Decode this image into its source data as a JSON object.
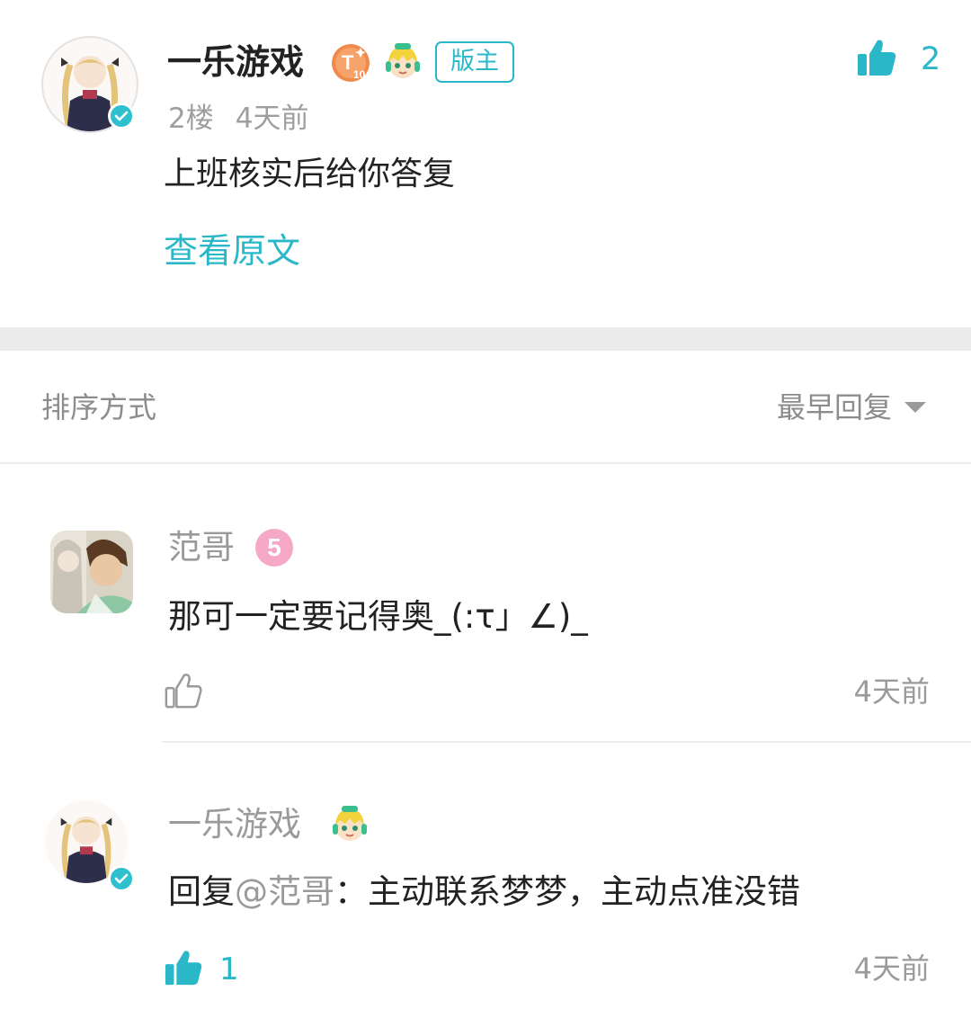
{
  "post": {
    "author": "一乐游戏",
    "level_badge": "T10",
    "mod_badge": "版主",
    "floor": "2楼",
    "time": "4天前",
    "content": "上班核实后给你答复",
    "view_original": "查看原文",
    "like_count": "2"
  },
  "sort": {
    "label": "排序方式",
    "selected": "最早回复"
  },
  "replies": [
    {
      "author": "范哥",
      "level": "5",
      "content": "那可一定要记得奥_(:τ」∠)_",
      "time": "4天前",
      "like_count": ""
    },
    {
      "author": "一乐游戏",
      "reply_prefix": "回复",
      "mention": "@范哥",
      "content": "：主动联系梦梦，主动点准没错",
      "time": "4天前",
      "like_count": "1"
    }
  ],
  "colors": {
    "accent": "#2ab8c8",
    "muted_text": "#9a9a9a",
    "separator": "#ececec",
    "level_pink": "#f6a9c7",
    "level_orange": "#f08a4b"
  },
  "icons": [
    "thumbs-up-icon",
    "verified-icon",
    "caret-down-icon",
    "mascot-icon",
    "level-badge-icon"
  ]
}
